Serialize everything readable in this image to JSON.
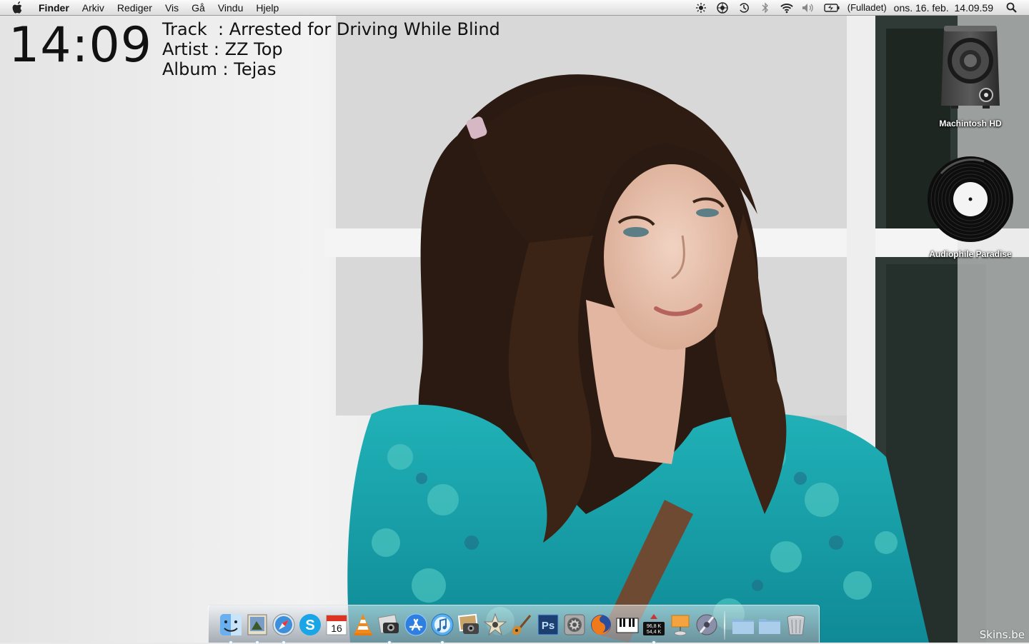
{
  "menubar": {
    "app_name": "Finder",
    "menus": [
      "Arkiv",
      "Rediger",
      "Vis",
      "Gå",
      "Vindu",
      "Hjelp"
    ],
    "status_icons": [
      "brightness-icon",
      "sync-icon",
      "time-machine-icon",
      "bluetooth-icon",
      "wifi-icon",
      "volume-icon",
      "battery-icon"
    ],
    "battery_status": "(Fulladet)",
    "datetime": "ons. 16. feb.  14.09.59"
  },
  "overlay": {
    "clock": "14:09",
    "track_line": "Track  : Arrested for Driving While Blind",
    "artist_line": "Artist : ZZ Top",
    "album_line": "Album : Tejas"
  },
  "desktop": {
    "icons": [
      {
        "label": "Machintosh HD",
        "icon": "hard-drive-speaker-icon"
      },
      {
        "label": "Audiophile Paradise",
        "icon": "vinyl-record-icon"
      }
    ]
  },
  "dock": {
    "items": [
      {
        "name": "finder-icon",
        "running": true
      },
      {
        "name": "preview-icon",
        "running": true
      },
      {
        "name": "safari-icon",
        "running": true
      },
      {
        "name": "skype-icon",
        "running": false
      },
      {
        "name": "ical-icon",
        "label": "16",
        "running": false
      },
      {
        "name": "vlc-icon",
        "running": false
      },
      {
        "name": "image-capture-icon",
        "running": true
      },
      {
        "name": "app-store-icon",
        "running": false
      },
      {
        "name": "itunes-icon",
        "running": true
      },
      {
        "name": "iphoto-icon",
        "running": false
      },
      {
        "name": "imovie-star-icon",
        "running": false
      },
      {
        "name": "garageband-icon",
        "running": false
      },
      {
        "name": "photoshop-icon",
        "label": "Ps",
        "running": false
      },
      {
        "name": "system-preferences-icon",
        "running": false
      },
      {
        "name": "firefox-icon",
        "running": false
      },
      {
        "name": "piano-icon",
        "running": false
      },
      {
        "name": "network-monitor-icon",
        "net_down": "96,8 K",
        "net_up": "54,4 K",
        "running": true
      },
      {
        "name": "presentation-icon",
        "running": false
      },
      {
        "name": "instruments-icon",
        "running": false
      }
    ],
    "stacks": [
      "documents-folder-icon",
      "downloads-folder-icon",
      "trash-icon"
    ]
  },
  "watermark": "Skins.be",
  "colors": {
    "wallpaper_bg": "#ececec",
    "hair": "#2a1a12",
    "dress": "#1aa7b0",
    "menubar": "#e8e8e8"
  }
}
